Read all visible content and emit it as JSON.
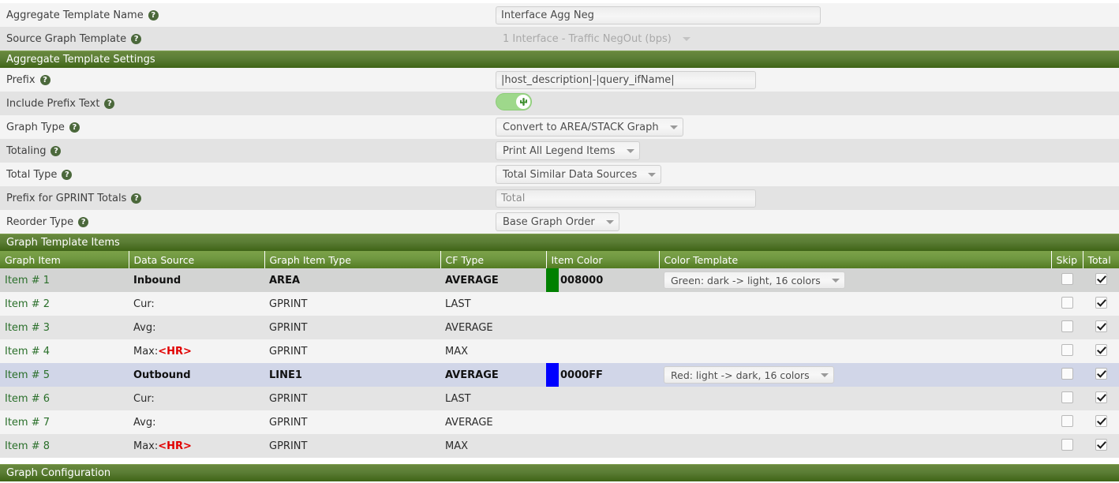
{
  "form": {
    "rows": [
      {
        "label": "Aggregate Template Name",
        "help": "help-icon",
        "control": "text",
        "value": "Interface Agg Neg",
        "placeholder": ""
      },
      {
        "label": "Source Graph Template",
        "help": "help-icon",
        "control": "select-disabled",
        "value": "1 Interface - Traffic NegOut (bps)"
      }
    ]
  },
  "section_settings": {
    "title": "Aggregate Template Settings"
  },
  "settings": {
    "rows": [
      {
        "label": "Prefix",
        "control": "text",
        "value": "|host_description|-|query_ifName|",
        "placeholder": ""
      },
      {
        "label": "Include Prefix Text",
        "control": "toggle",
        "state": "on",
        "icon": "cactus-icon"
      },
      {
        "label": "Graph Type",
        "control": "select",
        "value": "Convert to AREA/STACK Graph"
      },
      {
        "label": "Totaling",
        "control": "select",
        "value": "Print All Legend Items"
      },
      {
        "label": "Total Type",
        "control": "select",
        "value": "Total Similar Data Sources"
      },
      {
        "label": "Prefix for GPRINT Totals",
        "control": "text",
        "value": "",
        "placeholder": "Total"
      },
      {
        "label": "Reorder Type",
        "control": "select",
        "value": "Base Graph Order"
      }
    ]
  },
  "section_items": {
    "title": "Graph Template Items"
  },
  "items_table": {
    "columns": [
      "Graph Item",
      "Data Source",
      "Graph Item Type",
      "CF Type",
      "Item Color",
      "Color Template",
      "Skip",
      "Total"
    ],
    "rows": [
      {
        "graph_item": "Item # 1",
        "data_source": "Inbound",
        "item_type": "AREA",
        "cf_type": "AVERAGE",
        "item_color_hex": "008000",
        "swatch": "#008000",
        "color_template": "Green: dark -> light, 16 colors",
        "skip": false,
        "total": true,
        "bold": true,
        "style": "first"
      },
      {
        "graph_item": "Item # 2",
        "data_source": "Cur:",
        "item_type": "GPRINT",
        "cf_type": "LAST",
        "item_color_hex": "",
        "swatch": "",
        "color_template": "",
        "skip": false,
        "total": true,
        "bold": false,
        "style": "light"
      },
      {
        "graph_item": "Item # 3",
        "data_source": "Avg:",
        "item_type": "GPRINT",
        "cf_type": "AVERAGE",
        "item_color_hex": "",
        "swatch": "",
        "color_template": "",
        "skip": false,
        "total": true,
        "bold": false,
        "style": "dark"
      },
      {
        "graph_item": "Item # 4",
        "data_source": "Max:",
        "data_source_tag": "<HR>",
        "item_type": "GPRINT",
        "cf_type": "MAX",
        "item_color_hex": "",
        "swatch": "",
        "color_template": "",
        "skip": false,
        "total": true,
        "bold": false,
        "style": "light"
      },
      {
        "graph_item": "Item # 5",
        "data_source": "Outbound",
        "item_type": "LINE1",
        "cf_type": "AVERAGE",
        "item_color_hex": "0000FF",
        "swatch": "#0000FF",
        "color_template": "Red: light -> dark, 16 colors",
        "skip": false,
        "total": true,
        "bold": true,
        "style": "selected"
      },
      {
        "graph_item": "Item # 6",
        "data_source": "Cur:",
        "item_type": "GPRINT",
        "cf_type": "LAST",
        "item_color_hex": "",
        "swatch": "",
        "color_template": "",
        "skip": false,
        "total": true,
        "bold": false,
        "style": "dark"
      },
      {
        "graph_item": "Item # 7",
        "data_source": "Avg:",
        "item_type": "GPRINT",
        "cf_type": "AVERAGE",
        "item_color_hex": "",
        "swatch": "",
        "color_template": "",
        "skip": false,
        "total": true,
        "bold": false,
        "style": "light"
      },
      {
        "graph_item": "Item # 8",
        "data_source": "Max:",
        "data_source_tag": "<HR>",
        "item_type": "GPRINT",
        "cf_type": "MAX",
        "item_color_hex": "",
        "swatch": "",
        "color_template": "",
        "skip": false,
        "total": true,
        "bold": false,
        "style": "dark"
      }
    ]
  },
  "section_graph_config": {
    "title": "Graph Configuration"
  },
  "colors": {
    "section_bar_top": "#69893e",
    "section_bar_bottom": "#3f6416",
    "table_header_top": "#7ca249",
    "table_header_bottom": "#537b22",
    "help_icon": "#4b683b",
    "selected_row": "#d1d6e8",
    "hr_tag": "#e10000",
    "item_link": "#2a6f2a",
    "toggle_on": "#9ed88b"
  }
}
